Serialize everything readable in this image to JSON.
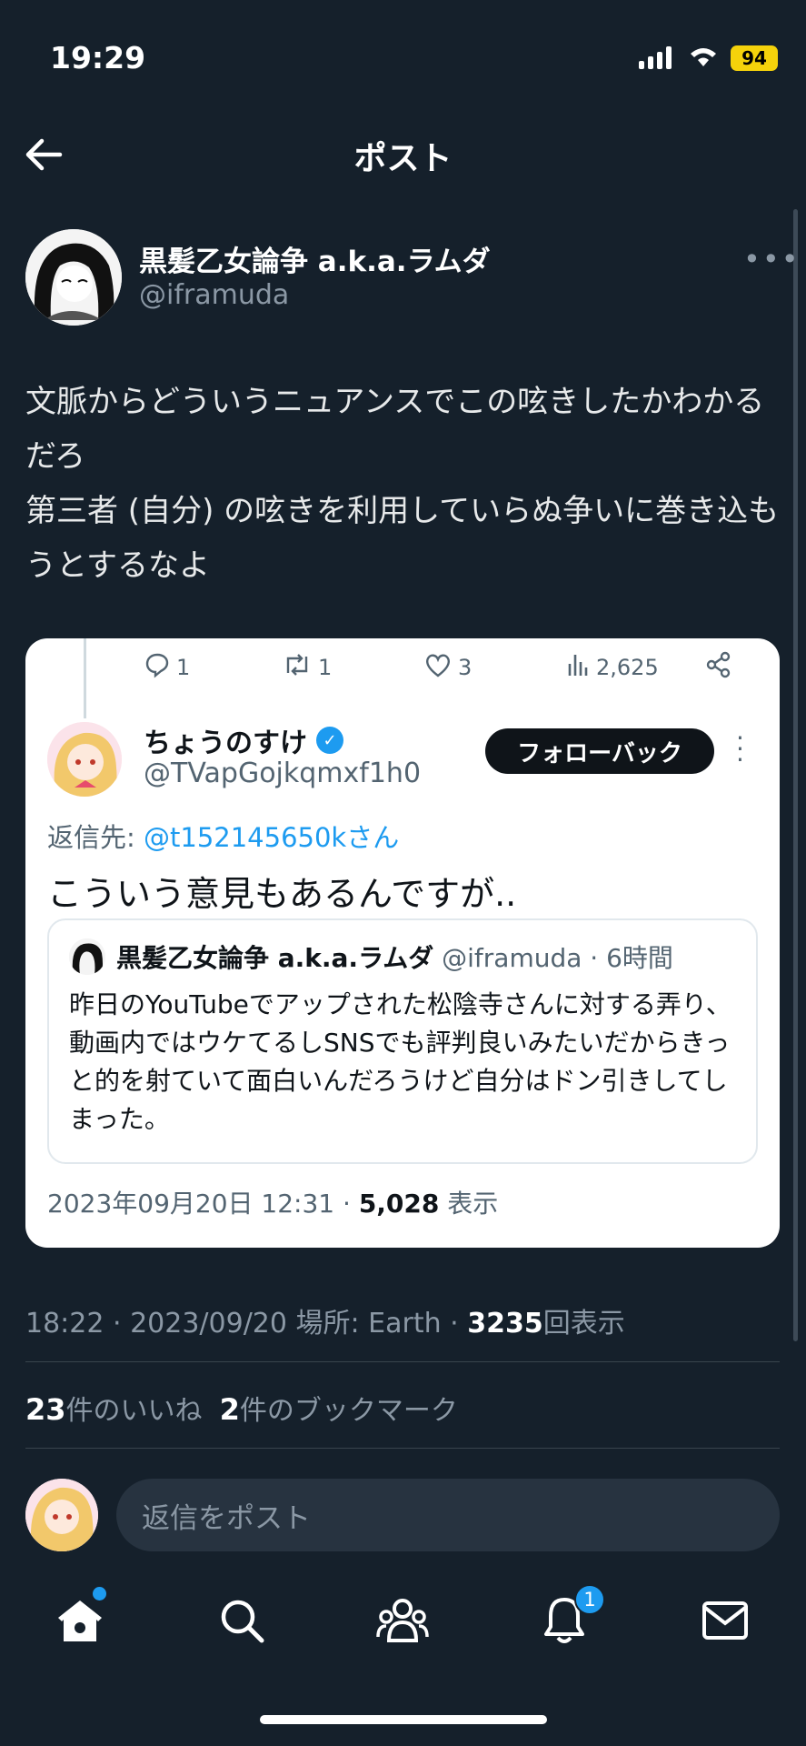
{
  "status_bar": {
    "time": "19:29",
    "battery": "94"
  },
  "header": {
    "title": "ポスト"
  },
  "post": {
    "author_name": "黒髪乙女論争 a.k.a.ラムダ",
    "author_handle": "@iframuda",
    "more": "•••",
    "text": "文脈からどういうニュアンスでこの呟きしたかわかるだろ\n第三者 (自分) の呟きを利用していらぬ争いに巻き込もうとするなよ",
    "meta_time": "18:22 · 2023/09/20 場所: Earth · ",
    "meta_views_count": "3235",
    "meta_views_label": "回表示",
    "likes_count": "23",
    "likes_label": "件のいいね",
    "bookmarks_count": "2",
    "bookmarks_label": "件のブックマーク"
  },
  "embedded": {
    "actions": {
      "replies": "1",
      "reposts": "1",
      "likes": "3",
      "views": "2,625"
    },
    "author_name": "ちょうのすけ",
    "author_handle": "@TVapGojkqmxf1h0",
    "follow_label": "フォローバック",
    "reply_to_label": "返信先: ",
    "reply_to_handle": "@t152145650kさん",
    "text": "こういう意見もあるんですが..",
    "quote": {
      "author_name": "黒髪乙女論争 a.k.a.ラムダ",
      "meta": " @iframuda · 6時間",
      "text": "昨日のYouTubeでアップされた松陰寺さんに対する弄り、動画内ではウケてるしSNSでも評判良いみたいだからきっと的を射ていて面白いんだろうけど自分はドン引きしてしまった。"
    },
    "footer_date": "2023年09月20日 12:31 · ",
    "footer_views_count": "5,028",
    "footer_views_label": " 表示"
  },
  "reply_bar": {
    "placeholder": "返信をポスト"
  },
  "nav": {
    "notification_count": "1"
  },
  "colors": {
    "background": "#15202b",
    "accent": "#1d9bf0",
    "battery": "#f5d20b"
  }
}
